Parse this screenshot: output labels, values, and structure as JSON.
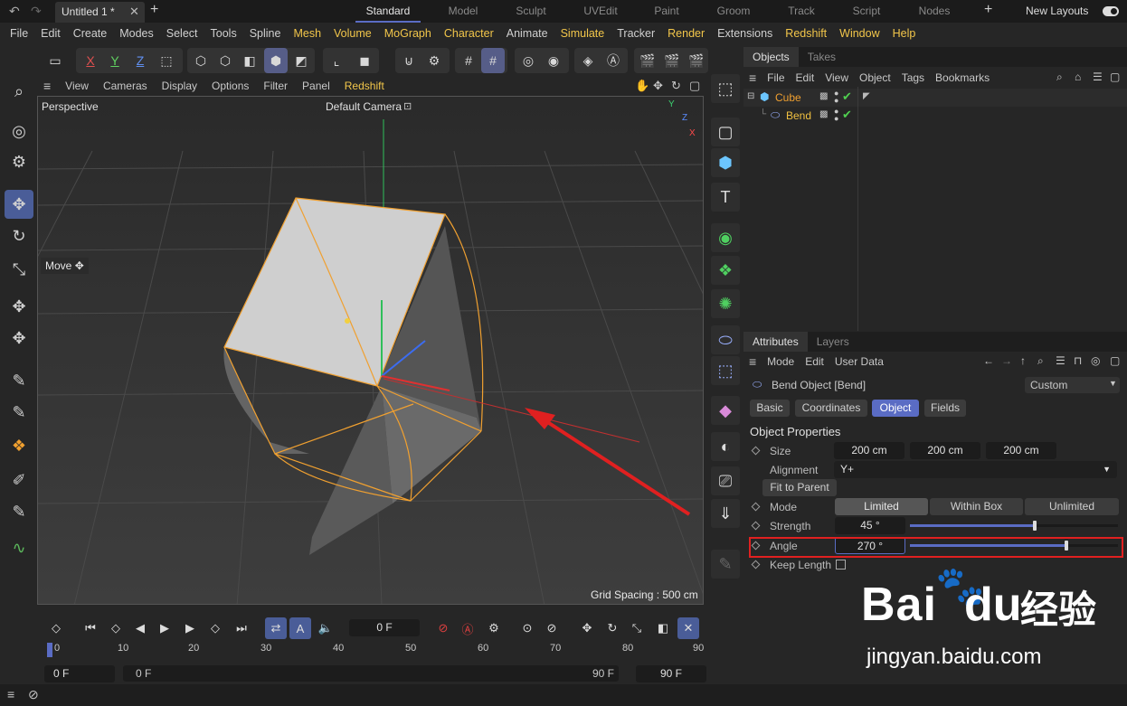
{
  "tabbar": {
    "doc_title": "Untitled 1 *",
    "layouts": [
      "Standard",
      "Model",
      "Sculpt",
      "UVEdit",
      "Paint",
      "Groom",
      "Track",
      "Script",
      "Nodes"
    ],
    "active_layout": "Standard",
    "new_layouts": "New Layouts"
  },
  "menubar": {
    "items": [
      "File",
      "Edit",
      "Create",
      "Modes",
      "Select",
      "Tools",
      "Spline",
      "Mesh",
      "Volume",
      "MoGraph",
      "Character",
      "Animate",
      "Simulate",
      "Tracker",
      "Render",
      "Extensions",
      "Redshift",
      "Window",
      "Help"
    ],
    "highlight_items": [
      "Mesh",
      "Volume",
      "MoGraph",
      "Character",
      "Simulate",
      "Render",
      "Redshift",
      "Window"
    ]
  },
  "toolbar": {
    "axis_x": "X",
    "axis_y": "Y",
    "axis_z": "Z"
  },
  "viewport": {
    "menu": [
      "View",
      "Cameras",
      "Display",
      "Options",
      "Filter",
      "Panel",
      "Redshift"
    ],
    "label": "Perspective",
    "camera": "Default Camera",
    "grid_spacing": "Grid Spacing : 500 cm",
    "move_tooltip": "Move",
    "gizmo_y": "Y",
    "gizmo_z": "Z",
    "gizmo_x": "X"
  },
  "objects_panel": {
    "tabs": [
      "Objects",
      "Takes"
    ],
    "menu": [
      "File",
      "Edit",
      "View",
      "Object",
      "Tags",
      "Bookmarks"
    ],
    "items": [
      {
        "name": "Cube",
        "color": "#f0a030"
      },
      {
        "name": "Bend",
        "color": "#f0c040"
      }
    ]
  },
  "attributes_panel": {
    "tabs": [
      "Attributes",
      "Layers"
    ],
    "menu": [
      "Mode",
      "Edit",
      "User Data"
    ],
    "object_title": "Bend Object [Bend]",
    "preset": "Custom",
    "sub_tabs": [
      "Basic",
      "Coordinates",
      "Object",
      "Fields"
    ],
    "active_sub_tab": "Object",
    "section": "Object Properties",
    "size_label": "Size",
    "size_values": [
      "200 cm",
      "200 cm",
      "200 cm"
    ],
    "alignment_label": "Alignment",
    "alignment_value": "Y+",
    "fit_to_parent": "Fit to Parent",
    "mode_label": "Mode",
    "mode_options": [
      "Limited",
      "Within Box",
      "Unlimited"
    ],
    "mode_selected": "Limited",
    "strength_label": "Strength",
    "strength_value": "45 °",
    "strength_slider": 0.6,
    "angle_label": "Angle",
    "angle_value": "270 °",
    "angle_slider": 0.75,
    "keep_length_label": "Keep Length"
  },
  "timeline": {
    "frame_field": "0 F",
    "ticks": [
      "0",
      "10",
      "20",
      "30",
      "40",
      "50",
      "60",
      "70",
      "80",
      "90"
    ],
    "start": "0 F",
    "range_start": "0 F",
    "range_end": "90 F",
    "end": "90 F"
  },
  "watermark": {
    "brand": "Bai",
    "brand2": "du",
    "cn": "经验",
    "url": "jingyan.baidu.com"
  },
  "colors": {
    "accent": "#5a6cc4",
    "highlight_menu": "#f2c64a",
    "selection_outline": "#f0a030",
    "annotation_red": "#e02020"
  }
}
